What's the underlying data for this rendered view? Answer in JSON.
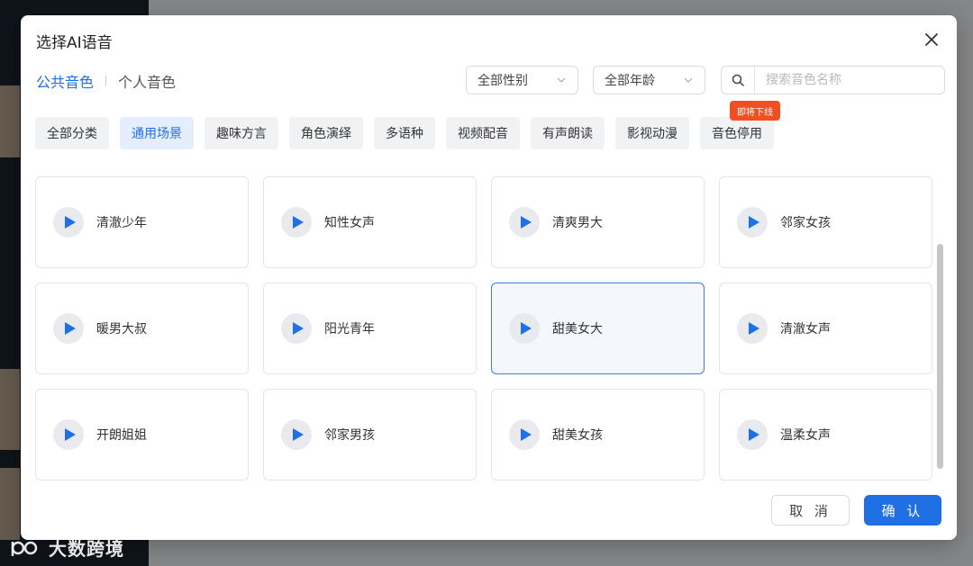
{
  "dialog": {
    "title": "选择AI语音"
  },
  "tabs": [
    {
      "label": "公共音色",
      "active": true
    },
    {
      "label": "个人音色",
      "active": false
    }
  ],
  "filters": {
    "gender": "全部性别",
    "age": "全部年龄",
    "search_placeholder": "搜索音色名称"
  },
  "categories": [
    {
      "label": "全部分类",
      "active": false
    },
    {
      "label": "通用场景",
      "active": true
    },
    {
      "label": "趣味方言",
      "active": false
    },
    {
      "label": "角色演绎",
      "active": false
    },
    {
      "label": "多语种",
      "active": false
    },
    {
      "label": "视频配音",
      "active": false
    },
    {
      "label": "有声朗读",
      "active": false
    },
    {
      "label": "影视动漫",
      "active": false
    },
    {
      "label": "音色停用",
      "active": false,
      "badge": "即将下线"
    }
  ],
  "voices": [
    {
      "name": "清澈少年",
      "selected": false
    },
    {
      "name": "知性女声",
      "selected": false
    },
    {
      "name": "清爽男大",
      "selected": false
    },
    {
      "name": "邻家女孩",
      "selected": false
    },
    {
      "name": "暖男大叔",
      "selected": false
    },
    {
      "name": "阳光青年",
      "selected": false
    },
    {
      "name": "甜美女大",
      "selected": true
    },
    {
      "name": "清澈女声",
      "selected": false
    },
    {
      "name": "开朗姐姐",
      "selected": false
    },
    {
      "name": "邻家男孩",
      "selected": false
    },
    {
      "name": "甜美女孩",
      "selected": false
    },
    {
      "name": "温柔女声",
      "selected": false
    }
  ],
  "buttons": {
    "cancel": "取 消",
    "ok": "确 认"
  },
  "watermark": "大数跨境",
  "colors": {
    "accent": "#1f6fe5",
    "badge": "#ef4f23"
  }
}
